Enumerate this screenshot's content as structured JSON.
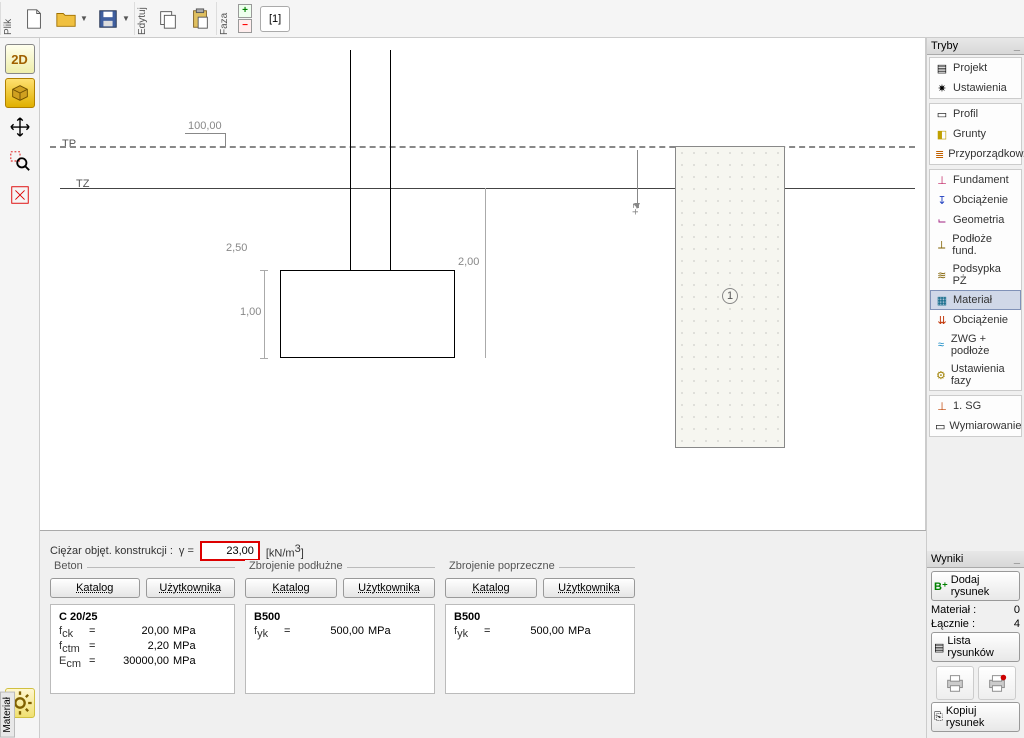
{
  "toolbar": {
    "file_label": "Plik",
    "edit_label": "Edytuj",
    "phase_label": "Faza",
    "tab1": "[1]"
  },
  "canvas": {
    "dim_top": "100,00",
    "dim_height": "2,50",
    "dim_block_h": "1,00",
    "dim_right": "2,00",
    "label_tp": "TP",
    "label_tz": "TZ",
    "vlabel_z": "+z",
    "soil_id": "1"
  },
  "bottom": {
    "tab_label": "Materiał",
    "weight_label": "Ciężar objęt. konstrukcji :",
    "gamma": "γ =",
    "weight_value": "23,00",
    "weight_unit_html": "[kN/m³]",
    "beton": {
      "title": "Beton",
      "btn_catalog": "Katalog",
      "btn_user": "Użytkownika",
      "name": "C 20/25",
      "fck_k": "f",
      "fck_sub": "ck",
      "fck_v": "20,00",
      "fck_u": "MPa",
      "fctm_k": "f",
      "fctm_sub": "ctm",
      "fctm_v": "2,20",
      "fctm_u": "MPa",
      "ecm_k": "E",
      "ecm_sub": "cm",
      "ecm_v": "30000,00",
      "ecm_u": "MPa"
    },
    "long": {
      "title": "Zbrojenie podłużne",
      "btn_catalog": "Katalog",
      "btn_user": "Użytkownika",
      "name": "B500",
      "fyk_k": "f",
      "fyk_sub": "yk",
      "fyk_v": "500,00",
      "fyk_u": "MPa"
    },
    "trans": {
      "title": "Zbrojenie poprzeczne",
      "btn_catalog": "Katalog",
      "btn_user": "Użytkownika",
      "name": "B500",
      "fyk_k": "f",
      "fyk_sub": "yk",
      "fyk_v": "500,00",
      "fyk_u": "MPa"
    }
  },
  "right": {
    "tryby": "Tryby",
    "items1": {
      "projekt": "Projekt",
      "ustawienia": "Ustawienia"
    },
    "items2": {
      "profil": "Profil",
      "grunty": "Grunty",
      "przyp": "Przyporządkow."
    },
    "items3": {
      "fundament": "Fundament",
      "obciazenie": "Obciążenie",
      "geometria": "Geometria",
      "podloze": "Podłoże fund.",
      "podsypka": "Podsypka PŻ",
      "material": "Materiał",
      "obc2": "Obciążenie",
      "zwg": "ZWG + podłoże",
      "ufazy": "Ustawienia fazy"
    },
    "items4": {
      "sg": "1. SG",
      "wymiar": "Wymiarowanie"
    },
    "wyniki": "Wyniki",
    "dodaj": "Dodaj rysunek",
    "material_row": "Materiał :",
    "material_val": "0",
    "lacznie": "Łącznie :",
    "lacznie_val": "4",
    "lista": "Lista rysunków",
    "kopiuj": "Kopiuj rysunek"
  }
}
